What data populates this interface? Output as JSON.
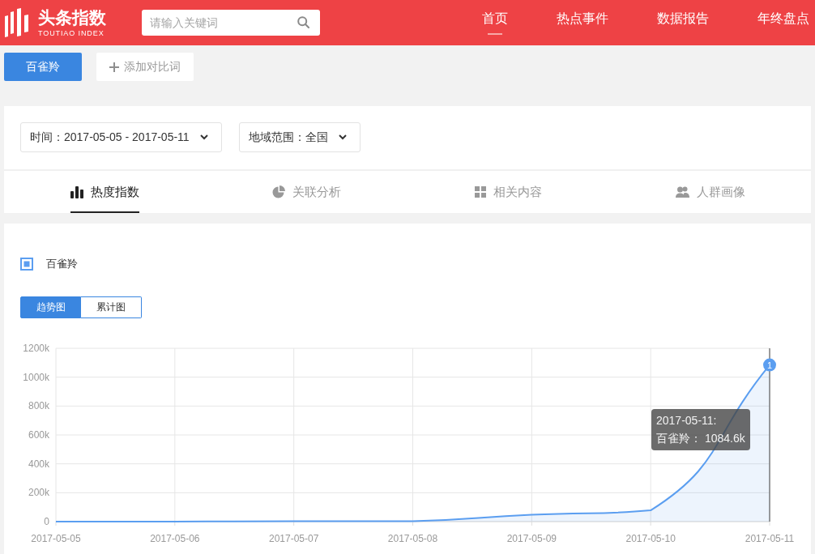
{
  "header": {
    "logo": {
      "title": "头条指数",
      "subtitle": "TOUTIAO INDEX"
    },
    "search": {
      "placeholder": "请输入关键词"
    },
    "nav": [
      {
        "label": "首页",
        "selected": true
      },
      {
        "label": "热点事件",
        "selected": false
      },
      {
        "label": "数据报告",
        "selected": false
      },
      {
        "label": "年终盘点",
        "selected": false
      }
    ]
  },
  "keywords": {
    "items": [
      "百雀羚"
    ],
    "add_button": "添加对比词"
  },
  "filters": [
    "时间：2017-05-05 - 2017-05-11",
    "地域范围：全国"
  ],
  "tabs": [
    {
      "label": "热度指数",
      "selected": true
    },
    {
      "label": "关联分析",
      "selected": false
    },
    {
      "label": "相关内容",
      "selected": false
    },
    {
      "label": "人群画像",
      "selected": false
    }
  ],
  "legend": [
    {
      "checked": true
    }
  ],
  "view_toggle": [
    {
      "label": "趋势图",
      "selected": true
    },
    {
      "label": "累计图",
      "selected": false
    }
  ],
  "chart": {
    "chart_data": {
      "type": "area",
      "grid": true,
      "categories": [
        "2017-05-05",
        "2017-05-06",
        "2017-05-07",
        "2017-05-08",
        "2017-05-09",
        "2017-05-10",
        "2017-05-11"
      ],
      "series": [
        {
          "name": "百雀羚",
          "color": "#5b9ef0",
          "values": [
            0,
            0,
            3000,
            2000,
            47000,
            78000,
            1084600
          ]
        }
      ],
      "ylim": [
        0,
        1200000
      ],
      "yticks": [
        {
          "value": 0,
          "label": "0"
        },
        {
          "value": 200000,
          "label": "200k"
        },
        {
          "value": 400000,
          "label": "400k"
        },
        {
          "value": 600000,
          "label": "600k"
        },
        {
          "value": 800000,
          "label": "800k"
        },
        {
          "value": 1000000,
          "label": "1000k"
        },
        {
          "value": 1200000,
          "label": "1200k"
        }
      ]
    },
    "hover": {
      "marker": "1",
      "tooltip_title": "2017-05-11:",
      "tooltip_text": "百雀羚： 1084.6k"
    }
  }
}
